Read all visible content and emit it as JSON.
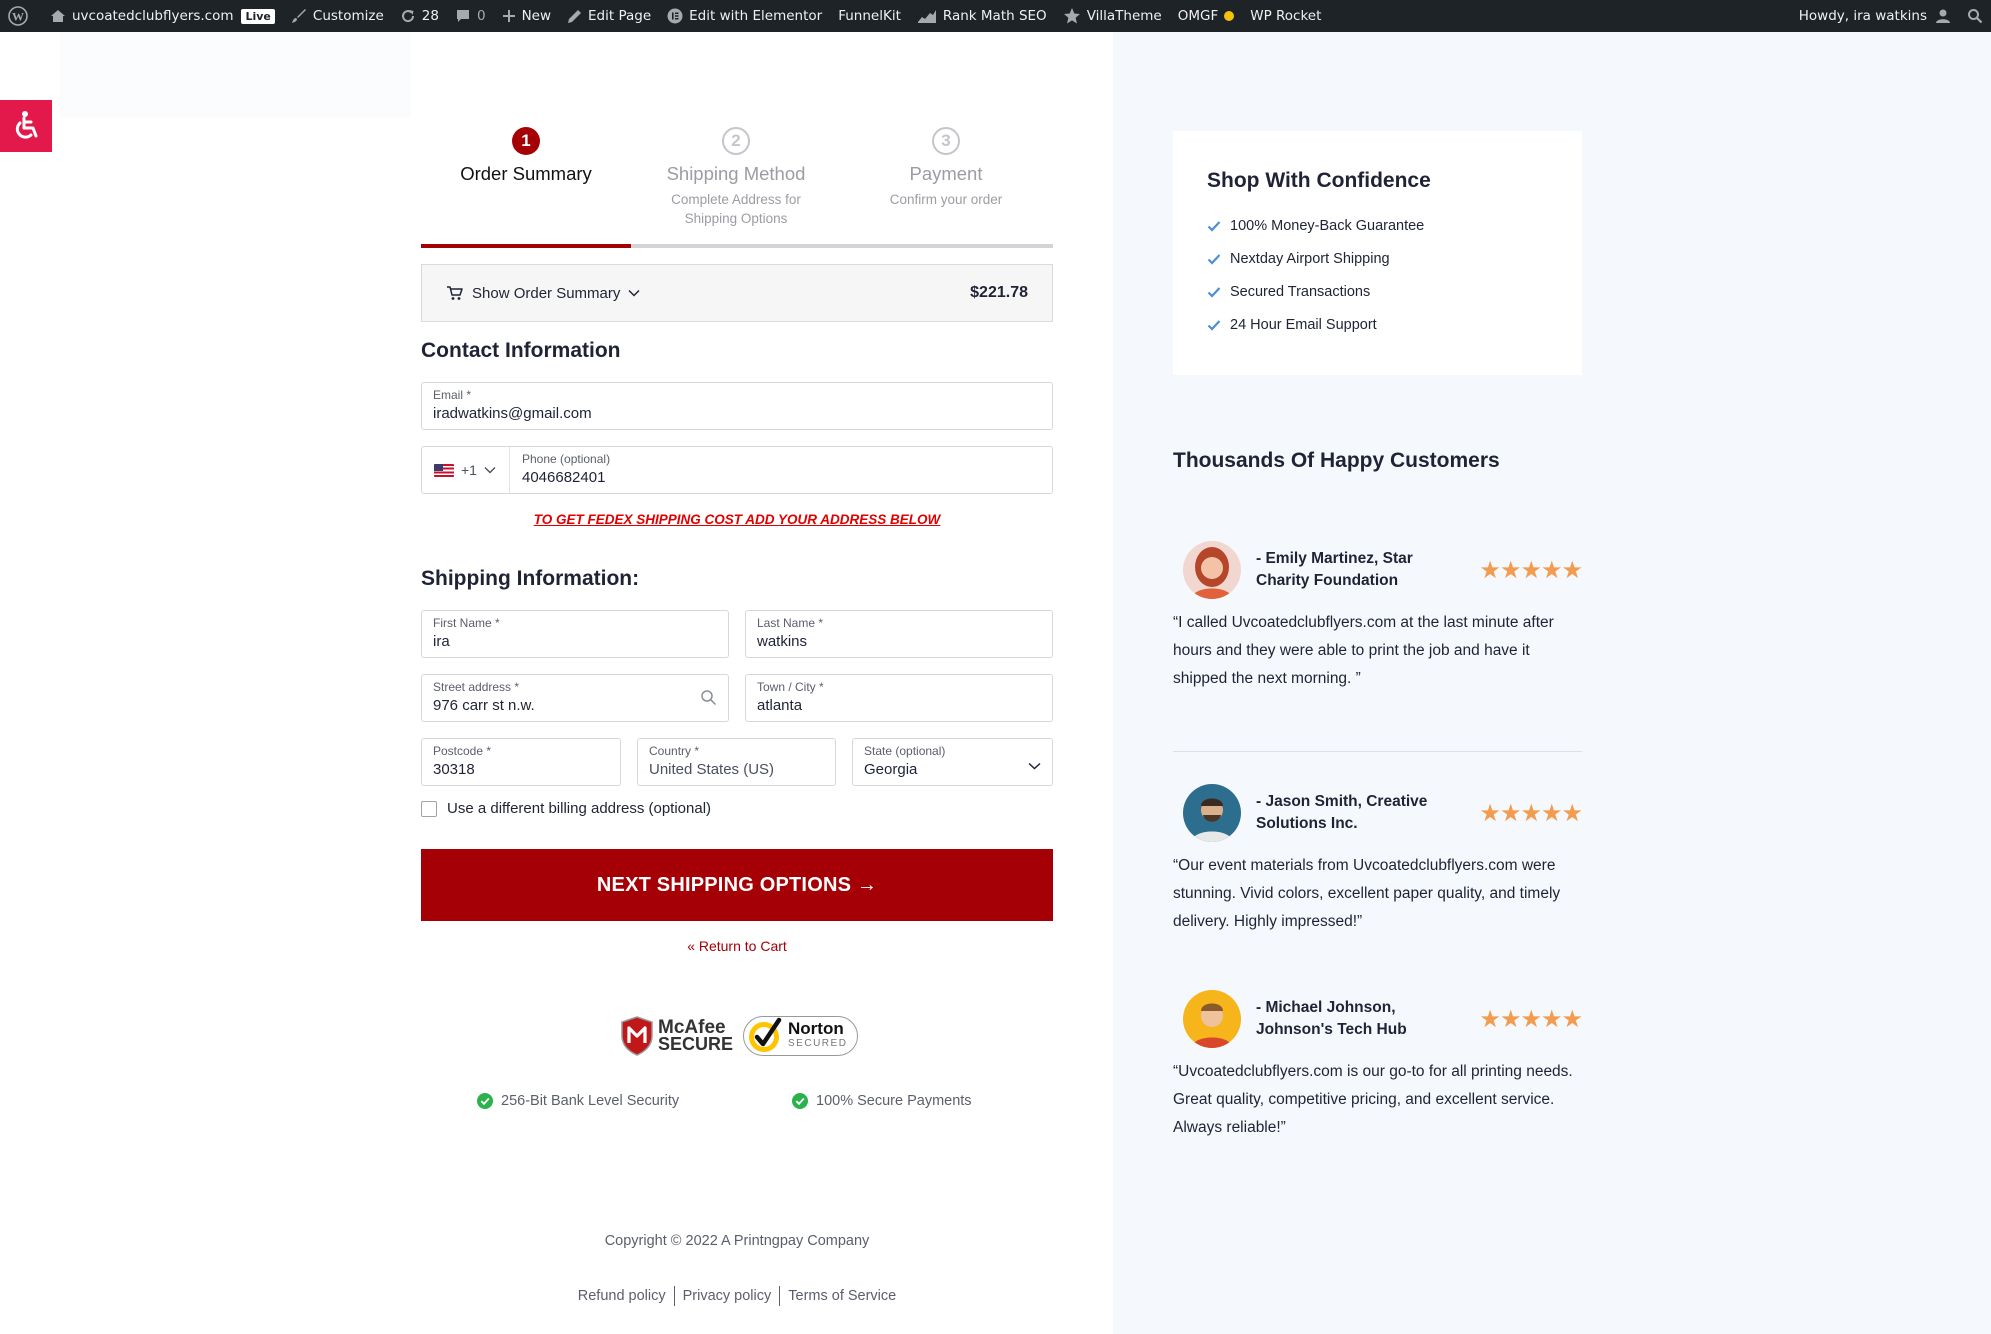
{
  "admin_bar": {
    "site_name": "uvcoatedclubflyers.com",
    "live_badge": "Live",
    "customize": "Customize",
    "updates_count": "28",
    "comments_count": "0",
    "new": "New",
    "edit_page": "Edit Page",
    "edit_elementor": "Edit with Elementor",
    "funnelkit": "FunnelKit",
    "rank_math": "Rank Math SEO",
    "villatheme": "VillaTheme",
    "omgf": "OMGF",
    "wp_rocket": "WP Rocket",
    "howdy": "Howdy, ira watkins"
  },
  "steps": [
    {
      "number": "1",
      "title": "Order Summary",
      "subtitle": ""
    },
    {
      "number": "2",
      "title": "Shipping Method",
      "subtitle": "Complete Address for Shipping Options"
    },
    {
      "number": "3",
      "title": "Payment",
      "subtitle": "Confirm your order"
    }
  ],
  "order_summary": {
    "toggle_label": "Show Order Summary",
    "total": "$221.78"
  },
  "contact": {
    "heading": "Contact Information",
    "email_label": "Email *",
    "email_value": "iradwatkins@gmail.com",
    "phone_code": "+1",
    "phone_label": "Phone (optional)",
    "phone_value": "4046682401"
  },
  "fedex_note": "TO GET FEDEX SHIPPING COST ADD YOUR ADDRESS BELOW",
  "shipping": {
    "heading": "Shipping Information:",
    "first_name_label": "First Name *",
    "first_name_value": "ira",
    "last_name_label": "Last Name *",
    "last_name_value": "watkins",
    "street_label": "Street address *",
    "street_value": "976 carr st n.w.",
    "city_label": "Town / City *",
    "city_value": "atlanta",
    "postcode_label": "Postcode *",
    "postcode_value": "30318",
    "country_label": "Country *",
    "country_value": "United States (US)",
    "state_label": "State (optional)",
    "state_value": "Georgia",
    "billing_checkbox_label": "Use a different billing address (optional)"
  },
  "next_button": "NEXT SHIPPING OPTIONS →",
  "return_link": "« Return to Cart",
  "badges": {
    "mcafee_brand": "McAfee",
    "mcafee_secure": "SECURE",
    "norton_brand": "Norton",
    "norton_secured": "SECURED"
  },
  "security": {
    "bank_level": "256-Bit Bank Level Security",
    "payments": "100% Secure Payments"
  },
  "footer": {
    "copyright": "Copyright © 2022 A Printngpay Company",
    "links": [
      "Refund policy",
      "Privacy policy",
      "Terms of Service"
    ]
  },
  "confidence": {
    "title": "Shop With Confidence",
    "items": [
      "100% Money-Back Guarantee",
      "Nextday Airport Shipping",
      "Secured Transactions",
      "24 Hour Email Support"
    ]
  },
  "testimonials": {
    "heading": "Thousands Of  Happy Customers",
    "rating": 5,
    "reviews": [
      {
        "name": "- Emily Martinez, Star Charity Foundation",
        "text": "“I called Uvcoatedclubflyers.com at the last minute after hours and they were able to print the job and have it shipped the next morning. ”"
      },
      {
        "name": "- Jason Smith, Creative Solutions Inc.",
        "text": "“Our event materials from Uvcoatedclubflyers.com were stunning. Vivid colors, excellent paper quality, and timely delivery. Highly impressed!”"
      },
      {
        "name": "- Michael Johnson, Johnson's Tech Hub",
        "text": "“Uvcoatedclubflyers.com is our go-to for all printing needs. Great quality, competitive pricing, and excellent service. Always reliable!”"
      }
    ]
  },
  "colors": {
    "brand_red": "#a40006",
    "accessibility_pink": "#e4194b",
    "star_orange": "#f39c4f",
    "check_blue": "#4a90d9",
    "secure_green": "#2bb24c"
  }
}
